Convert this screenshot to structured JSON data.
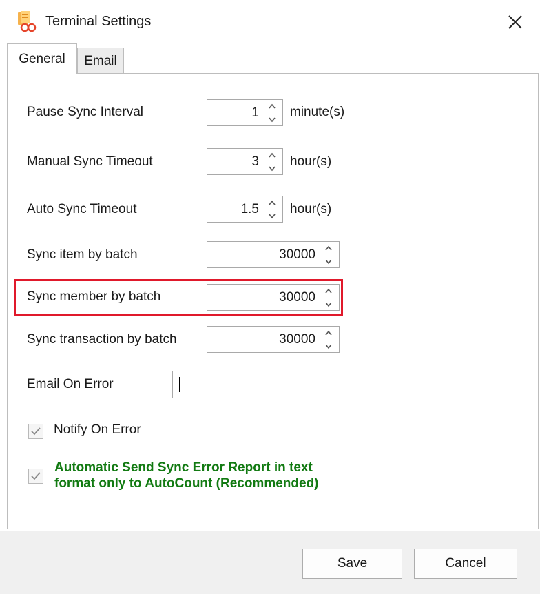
{
  "window": {
    "title": "Terminal Settings"
  },
  "tabs": [
    {
      "label": "General",
      "active": true
    },
    {
      "label": "Email",
      "active": false
    }
  ],
  "fields": {
    "pause_sync_interval": {
      "label": "Pause Sync Interval",
      "value": "1",
      "unit": "minute(s)"
    },
    "manual_sync_timeout": {
      "label": "Manual Sync Timeout",
      "value": "3",
      "unit": "hour(s)"
    },
    "auto_sync_timeout": {
      "label": "Auto Sync Timeout",
      "value": "1.5",
      "unit": "hour(s)"
    },
    "sync_item_by_batch": {
      "label": "Sync item by batch",
      "value": "30000"
    },
    "sync_member_by_batch": {
      "label": "Sync member by batch",
      "value": "30000"
    },
    "sync_transaction_by_batch": {
      "label": "Sync transaction by batch",
      "value": "30000"
    },
    "email_on_error": {
      "label": "Email On Error",
      "value": ""
    }
  },
  "checkboxes": {
    "notify_on_error": {
      "label": "Notify On Error",
      "checked": true
    },
    "auto_send_report": {
      "label_line1": "Automatic Send Sync Error Report in text",
      "label_line2": "format only to AutoCount (Recommended)",
      "checked": true
    }
  },
  "buttons": {
    "save": "Save",
    "cancel": "Cancel"
  },
  "colors": {
    "highlight": "#e0192b",
    "recommended_text": "#127a12"
  },
  "icons": {
    "app": "terminal-settings-app-icon",
    "close": "close-icon"
  }
}
